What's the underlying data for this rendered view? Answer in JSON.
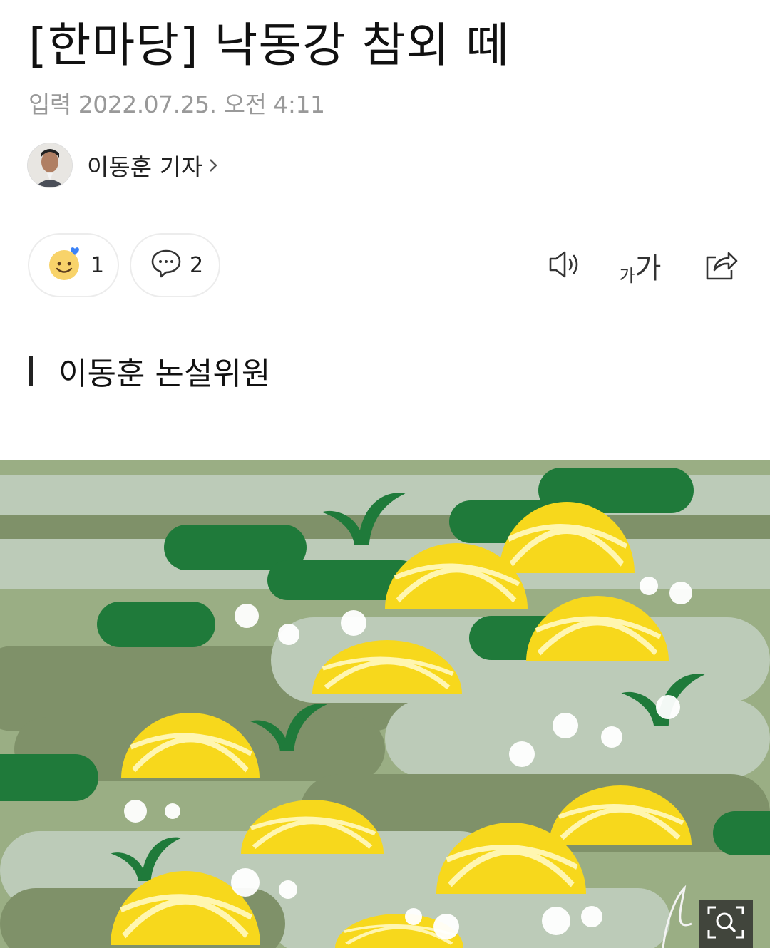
{
  "article": {
    "title": "[한마당] 낙동강 참외 떼",
    "date": "입력 2022.07.25. 오전 4:11",
    "author": "이동훈 기자",
    "section_label": "이동훈 논설위원"
  },
  "reactions": {
    "like_count": "1",
    "comment_count": "2"
  },
  "toolbar": {
    "font_small": "가",
    "font_big": "가"
  },
  "icons": [
    "smile-reaction-icon",
    "heart-icon",
    "comment-icon",
    "speaker-icon",
    "font-size-icon",
    "share-icon",
    "zoom-icon",
    "chevron-right-icon"
  ],
  "colors": {
    "illustration_bg": "#9aae84",
    "dark_green": "#1f7a3a",
    "melon_yellow": "#f7d81c",
    "light_band": "#bccbb8"
  }
}
